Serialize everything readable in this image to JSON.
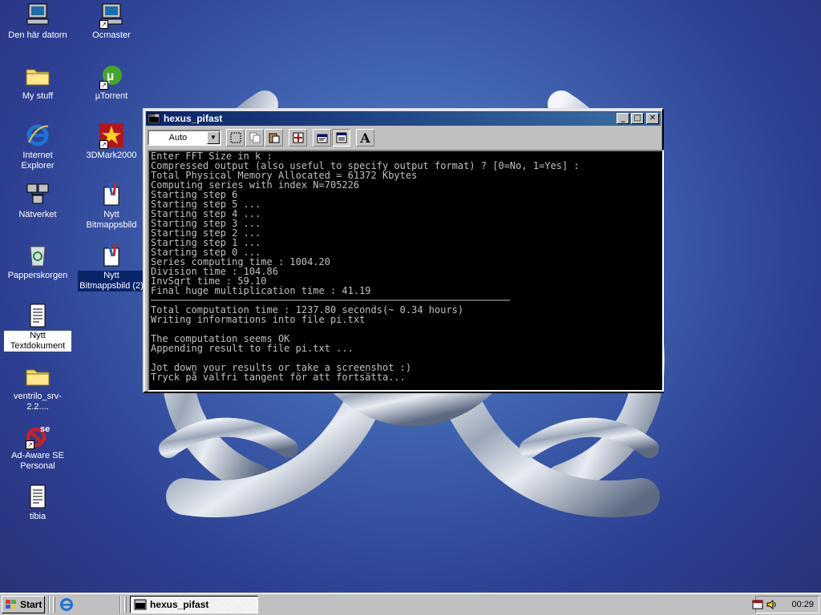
{
  "desktop": {
    "icons": [
      {
        "label": "Den här datorn",
        "icon": "my-computer-icon"
      },
      {
        "label": "My stuff",
        "icon": "folder-icon"
      },
      {
        "label": "Internet Explorer",
        "icon": "internet-explorer-icon"
      },
      {
        "label": "Nätverket",
        "icon": "network-icon"
      },
      {
        "label": "Papperskorgen",
        "icon": "recycle-bin-icon"
      },
      {
        "label": "Nytt Textdokument",
        "icon": "text-document-icon"
      },
      {
        "label": "ventrilo_srv-2.2....",
        "icon": "folder-icon"
      },
      {
        "label": "Ad-Aware SE Personal",
        "icon": "adaware-icon"
      },
      {
        "label": "tibia",
        "icon": "text-document-icon"
      },
      {
        "label": "Ocmaster",
        "icon": "computer-shortcut-icon"
      },
      {
        "label": "µTorrent",
        "icon": "utorrent-icon"
      },
      {
        "label": "3DMark2000",
        "icon": "3dmark-icon"
      },
      {
        "label": "Nytt Bitmappsbild",
        "icon": "paint-icon"
      },
      {
        "label": "Nytt Bitmappsbild (2)",
        "icon": "paint-icon"
      }
    ]
  },
  "window": {
    "title": "hexus_pifast",
    "title_icon": "ms-dos-icon",
    "minimize": "_",
    "maximize": "□",
    "close": "✕",
    "toolbar": {
      "font_select_value": "Auto",
      "tools": [
        "mark-icon",
        "copy-icon",
        "paste-icon",
        "fullscreen-icon",
        "properties-icon",
        "background-icon",
        "font-icon"
      ],
      "font_label": "A"
    },
    "console_lines": [
      "Enter FFT Size in k :",
      "Compressed output (also useful to specify output format) ? [0=No, 1=Yes] :",
      "Total Physical Memory Allocated = 61372 Kbytes",
      "Computing series with index N=705226",
      "Starting step 6",
      "Starting step 5 ...",
      "Starting step 4 ...",
      "Starting step 3 ...",
      "Starting step 2 ...",
      "Starting step 1 ...",
      "Starting step 0 ...",
      "Series computing time : 1004.20",
      "Division time : 104.86",
      "InvSqrt time : 59.10",
      "Final huge multiplication time : 41.19",
      "──────────────────────────────────────────────────────────────",
      "Total computation time : 1237.80 seconds(~ 0.34 hours)",
      "Writing informations into file pi.txt",
      "",
      "The computation seems OK",
      "Appending result to file pi.txt ...",
      "",
      "Jot down your results or take a screenshot :)",
      "Tryck på valfri tangent för att fortsätta..."
    ]
  },
  "taskbar": {
    "start_label": "Start",
    "task_label": "hexus_pifast",
    "clock": "00:29"
  }
}
